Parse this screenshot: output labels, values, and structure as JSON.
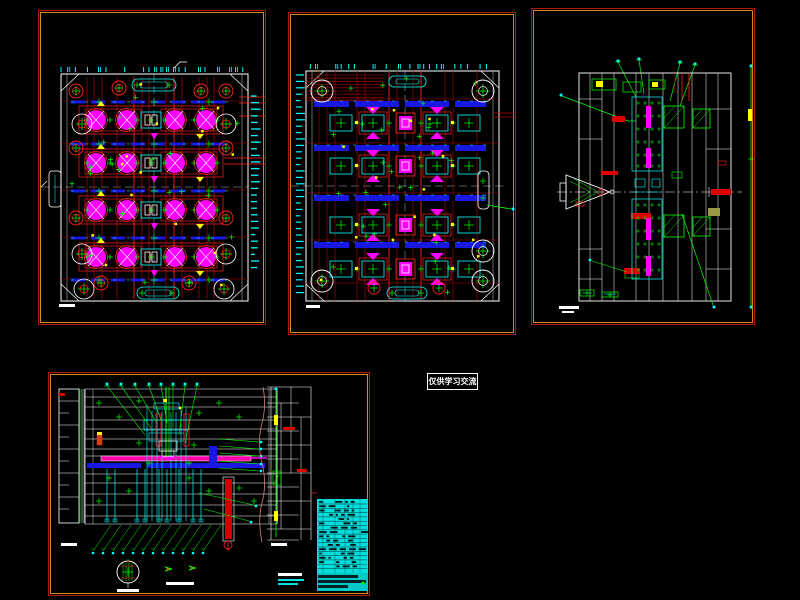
{
  "workspace": {
    "background": "#000000"
  },
  "watermark": {
    "text": "仅供学习交流"
  },
  "palette": {
    "red": "#ff2222",
    "dark_red": "#b00000",
    "bright_red": "#dd0000",
    "magenta": "#ff00ff",
    "pink_band": "#ff00aa",
    "cyan": "#00ffff",
    "green": "#00ff00",
    "blue": "#1818e0",
    "yellow": "#ffff00",
    "white": "#ffffff",
    "salmon": "#cc8080",
    "olive": "#999944",
    "table_fill": "#00dede",
    "sheet_border_outer": "#b51212",
    "sheet_border_inner": "#cf8b1b"
  },
  "sheets": [
    {
      "id": "sheet-1"
    },
    {
      "id": "sheet-2"
    },
    {
      "id": "sheet-3"
    },
    {
      "id": "sheet-4"
    }
  ]
}
